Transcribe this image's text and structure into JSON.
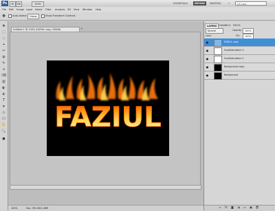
{
  "app": {
    "logo_text": "Ps",
    "top_buttons": [
      "Br",
      "Mb"
    ],
    "zoom": "100%",
    "workspaces": [
      "ESSENTIALS",
      "DESIGN",
      "PAINTING"
    ],
    "active_workspace": "DESIGN",
    "more_label": "»",
    "cs_live_label": "CS Live"
  },
  "menu": [
    "File",
    "Edit",
    "Image",
    "Layer",
    "Select",
    "Filter",
    "Analysis",
    "3D",
    "View",
    "Window",
    "Help"
  ],
  "options": {
    "auto_select_label": "Auto-Select:",
    "auto_select_value": "Group",
    "transform_label": "Show Transform Controls"
  },
  "tools": [
    "✥",
    "⬚",
    "◌",
    "⌖",
    "✂",
    "◍",
    "✎",
    "⌂",
    "⌫",
    "▥",
    "◐",
    "⬖",
    "T",
    "➤",
    "◇",
    "☐",
    "✋",
    "🔍",
    "◼"
  ],
  "document": {
    "tab_title": "Untitled-1 @ 100% (FAZIUL copy, RGB/8)",
    "close_glyph": "×",
    "artwork_text": "FAZIUL",
    "zoom_status": "100%",
    "doc_size": "Doc: 351.6K/1.48M"
  },
  "panel": {
    "tabs": [
      "LAYERS",
      "CHANNELS",
      "PATHS"
    ],
    "blend_mode": "Normal",
    "opacity_label": "Opacity:",
    "opacity_value": "100%",
    "lock_label": "Lock:",
    "fill_label": "Fill:",
    "fill_value": "100%",
    "layers": [
      {
        "name": "FAZIUL copy",
        "selected": true
      },
      {
        "name": "Hue/Saturation 2",
        "selected": false
      },
      {
        "name": "Hue/Saturation 1",
        "selected": false
      },
      {
        "name": "Background copy",
        "selected": false
      },
      {
        "name": "Background",
        "selected": false
      }
    ],
    "eye_glyph": "●",
    "bottom_icons": [
      "∞",
      "fx",
      "◙",
      "◑",
      "▭",
      "▣",
      "🗑"
    ]
  },
  "colors": {
    "accent_selected": "#3f8fd8",
    "canvas": "#000000",
    "fire_hot": "#fff6c8",
    "fire_mid": "#ffb21a",
    "fire_edge": "#e23a00"
  }
}
